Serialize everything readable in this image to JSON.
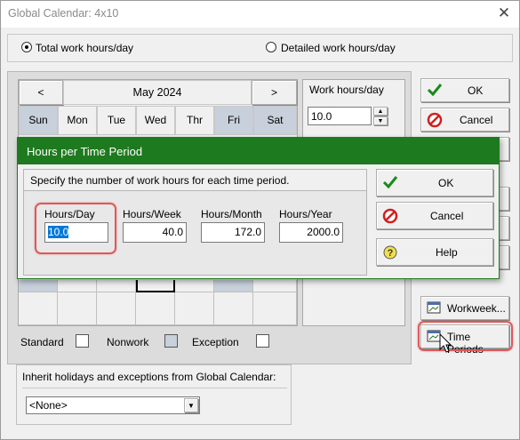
{
  "window": {
    "title": "Global Calendar: 4x10"
  },
  "mode": {
    "total_label": "Total work hours/day",
    "detailed_label": "Detailed work hours/day",
    "selected": "total"
  },
  "calendar": {
    "prev": "<",
    "next": ">",
    "month": "May 2024",
    "days": [
      "Sun",
      "Mon",
      "Tue",
      "Wed",
      "Thr",
      "Fri",
      "Sat"
    ]
  },
  "work_hours": {
    "label": "Work hours/day",
    "value": "10.0"
  },
  "right_buttons": {
    "ok": "OK",
    "cancel": "Cancel",
    "workweek": "Workweek...",
    "time_periods": "Time Periods"
  },
  "legend": {
    "standard": "Standard",
    "nonwork": "Nonwork",
    "exception": "Exception"
  },
  "inherit": {
    "label": "Inherit holidays and exceptions from Global Calendar:",
    "value": "<None>"
  },
  "dialog": {
    "title": "Hours per Time Period",
    "instruction": "Specify the number of work hours for each time period.",
    "fields": [
      {
        "label": "Hours/Day",
        "value": "10.0"
      },
      {
        "label": "Hours/Week",
        "value": "40.0"
      },
      {
        "label": "Hours/Month",
        "value": "172.0"
      },
      {
        "label": "Hours/Year",
        "value": "2000.0"
      }
    ],
    "ok": "OK",
    "cancel": "Cancel",
    "help": "Help"
  },
  "colors": {
    "dialog_title": "#1e7a1e",
    "highlight_ring": "#e05858",
    "weekend": "#c7d0db",
    "selected_text": "#0078d7"
  }
}
